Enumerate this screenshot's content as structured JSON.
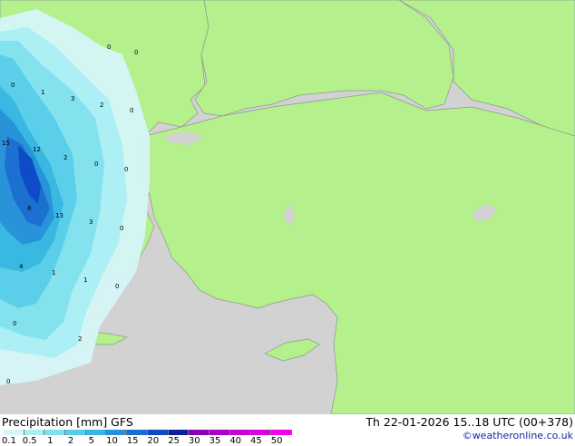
{
  "footer": {
    "title": "Precipitation [mm]  GFS",
    "datetime": "Th 22-01-2026 15..18 UTC (00+378)",
    "credit": "©weatheronline.co.uk"
  },
  "legend": {
    "ticks": [
      "0.1",
      "0.5",
      "1",
      "2",
      "5",
      "10",
      "15",
      "20",
      "25",
      "30",
      "35",
      "40",
      "45",
      "50"
    ],
    "colors": [
      "#d6f6f8",
      "#aaeef4",
      "#82e0ee",
      "#58cde8",
      "#38b6e2",
      "#2890d8",
      "#1a6ed0",
      "#0e4ac6",
      "#08229c",
      "#8c00b4",
      "#a800c8",
      "#c400d6",
      "#dc00e0",
      "#f000e8"
    ]
  },
  "map": {
    "land_color": "#b4f08c",
    "sea_color": "#d2d2d2",
    "contour_labels": [
      "0",
      "1",
      "3",
      "2",
      "0",
      "0",
      "12",
      "15",
      "2",
      "0",
      "0",
      "8",
      "13",
      "3",
      "0",
      "4",
      "1",
      "1",
      "0",
      "0",
      "2",
      "0",
      "0"
    ]
  }
}
